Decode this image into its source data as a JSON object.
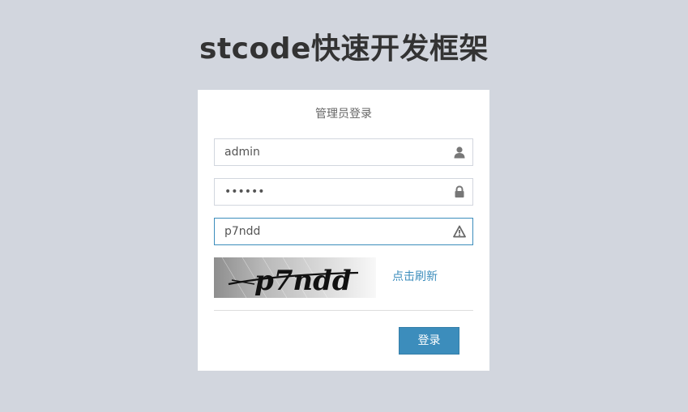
{
  "app": {
    "title": "stcode快速开发框架"
  },
  "login": {
    "heading": "管理员登录",
    "username": {
      "value": "admin",
      "icon": "user-icon"
    },
    "password": {
      "value": "123456",
      "icon": "lock-icon"
    },
    "captcha": {
      "value": "p7ndd",
      "icon": "warning-icon",
      "image_text": "p7ndd",
      "refresh_label": "点击刷新"
    },
    "submit_label": "登录"
  },
  "colors": {
    "background": "#d2d6de",
    "accent": "#3c8dbc",
    "title": "#333333"
  }
}
